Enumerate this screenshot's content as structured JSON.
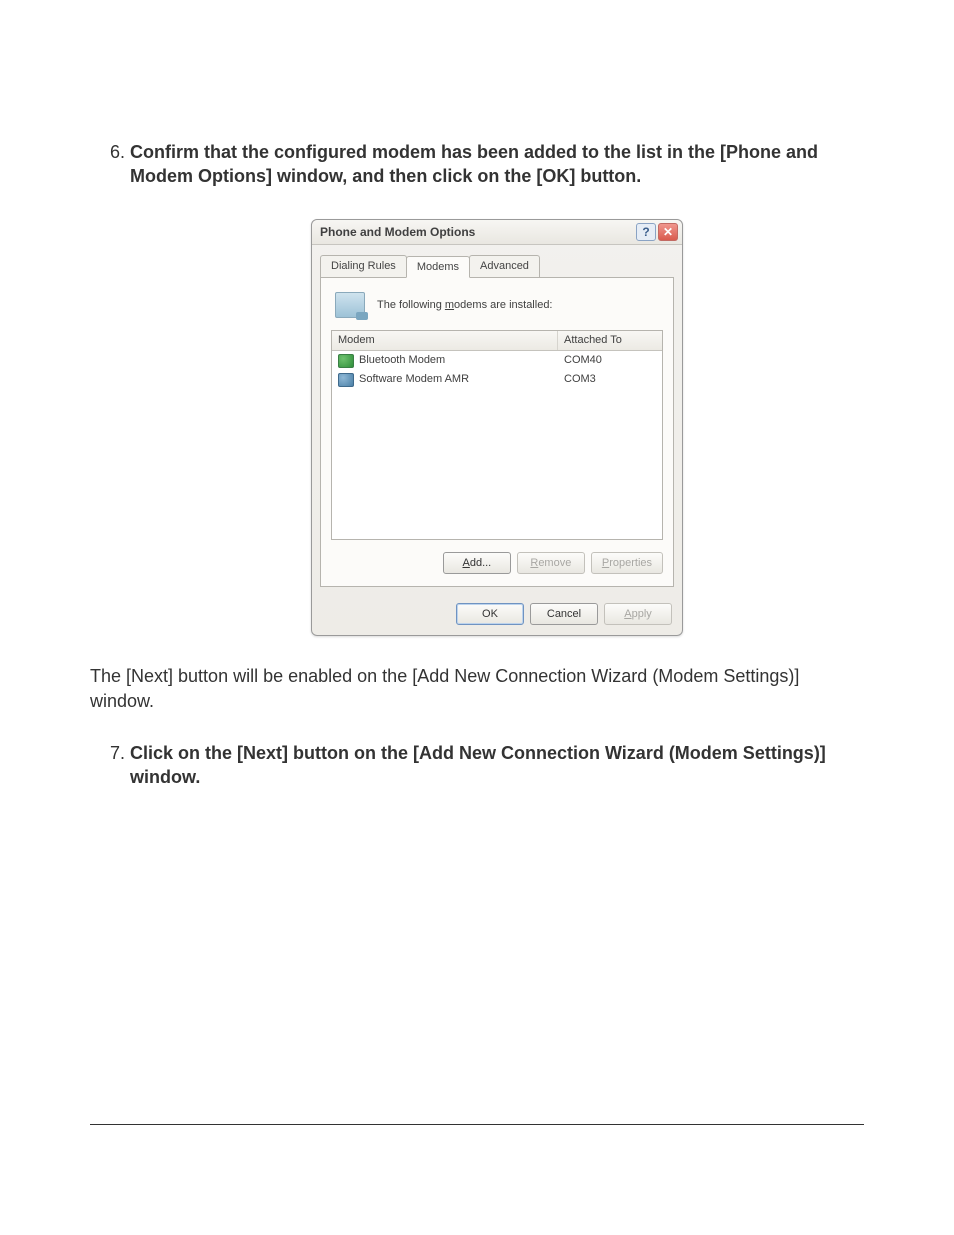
{
  "steps": {
    "first_number": "6",
    "step6": "Confirm that the configured modem has been added to the list in the [Phone and Modem Options] window, and then click on the [OK] button.",
    "interstitial": "The [Next] button will be enabled on the [Add New Connection Wizard (Modem Settings)] window.",
    "step7_number": "7",
    "step7": "Click on the [Next] button on the [Add New Connection Wizard (Modem Settings)] window."
  },
  "dialog": {
    "title": "Phone and Modem Options",
    "help_glyph": "?",
    "close_glyph": "✕",
    "tabs": {
      "dialing": "Dialing Rules",
      "modems": "Modems",
      "advanced": "Advanced"
    },
    "info_prefix": "The following ",
    "info_u": "m",
    "info_suffix": "odems are installed:",
    "columns": {
      "modem": "Modem",
      "attached": "Attached To"
    },
    "rows": [
      {
        "name": "Bluetooth Modem",
        "port": "COM40"
      },
      {
        "name": "Software Modem AMR",
        "port": "COM3"
      }
    ],
    "buttons": {
      "add_u": "A",
      "add_rest": "dd...",
      "remove_u": "R",
      "remove_rest": "emove",
      "props_u": "P",
      "props_rest": "roperties",
      "ok": "OK",
      "cancel": "Cancel",
      "apply_u": "A",
      "apply_rest": "pply"
    }
  }
}
